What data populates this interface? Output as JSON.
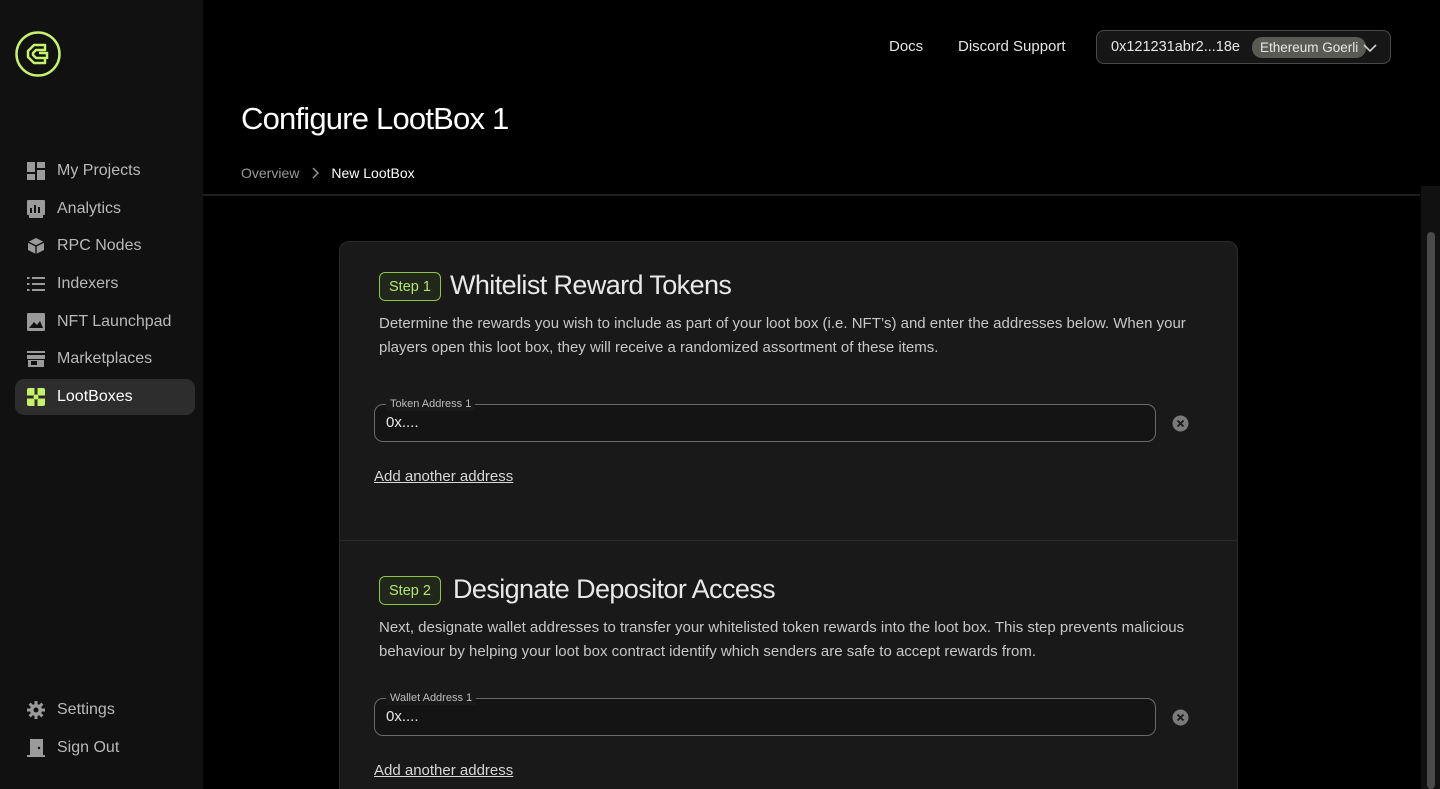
{
  "sidebar": {
    "items": [
      {
        "label": "My Projects",
        "icon": "dashboard-icon"
      },
      {
        "label": "Analytics",
        "icon": "analytics-icon"
      },
      {
        "label": "RPC Nodes",
        "icon": "cube-icon"
      },
      {
        "label": "Indexers",
        "icon": "list-icon"
      },
      {
        "label": "NFT Launchpad",
        "icon": "image-icon"
      },
      {
        "label": "Marketplaces",
        "icon": "store-icon"
      },
      {
        "label": "LootBoxes",
        "icon": "lootbox-icon"
      }
    ],
    "active_item": "LootBoxes",
    "bottom_items": [
      {
        "label": "Settings",
        "icon": "gear-icon"
      },
      {
        "label": "Sign Out",
        "icon": "sign-out-icon"
      }
    ]
  },
  "topbar": {
    "docs_label": "Docs",
    "discord_label": "Discord Support",
    "wallet_address": "0x121231abr2...18e",
    "network_label": "Ethereum Goerli"
  },
  "page": {
    "title": "Configure LootBox 1",
    "breadcrumb": {
      "overview": "Overview",
      "current": "New LootBox"
    }
  },
  "steps": [
    {
      "badge": "Step 1",
      "title": "Whitelist Reward Tokens",
      "description": "Determine the rewards you wish to include as part of your loot box (i.e. NFT’s) and enter the addresses below. When your players open this loot box, they will receive a randomized assortment of these items.",
      "field_label": "Token Address 1",
      "field_placeholder": "0x....",
      "add_label": "Add another address"
    },
    {
      "badge": "Step 2",
      "title": "Designate Depositor Access",
      "description": "Next, designate wallet addresses to transfer your whitelisted token rewards into the loot box. This step prevents malicious behaviour by helping your loot box contract identify which senders are safe to accept rewards from.",
      "field_label": "Wallet Address 1",
      "field_placeholder": "0x....",
      "add_label": "Add another address"
    }
  ],
  "colors": {
    "accent": "#b6e36f",
    "accent_border": "#8dc63f",
    "sidebar_bg": "#111111",
    "card_bg": "#191919",
    "active_nav_bg": "#2d2d2d"
  }
}
